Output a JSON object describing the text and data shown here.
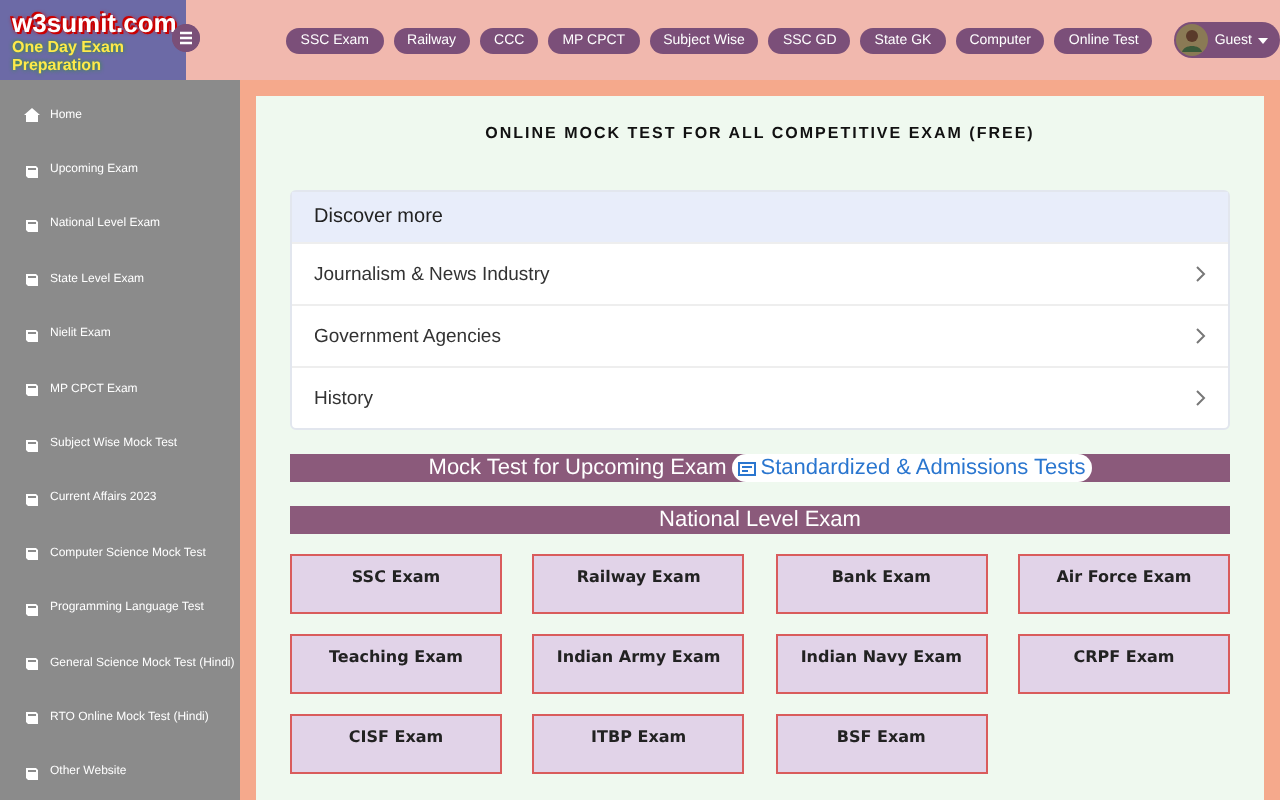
{
  "logo": {
    "title": "w3sumit.com",
    "tagline": "One Day Exam Preparation"
  },
  "nav": [
    "SSC Exam",
    "Railway",
    "CCC",
    "MP CPCT",
    "Subject Wise",
    "SSC GD",
    "State GK",
    "Computer",
    "Online Test"
  ],
  "user": {
    "label": "Guest"
  },
  "sidebar": {
    "items": [
      "Home",
      "Upcoming Exam",
      "National Level Exam",
      "State Level Exam",
      "Nielit Exam",
      "MP CPCT Exam",
      "Subject Wise Mock Test",
      "Current Affairs 2023",
      "Computer Science Mock Test",
      "Programming Language Test",
      "General Science Mock Test (Hindi)",
      "RTO Online Mock Test (Hindi)",
      "Other Website"
    ]
  },
  "page_title": "ONLINE MOCK TEST FOR ALL COMPETITIVE EXAM (FREE)",
  "discover": {
    "heading": "Discover more",
    "items": [
      "Journalism & News Industry",
      "Government Agencies",
      "History"
    ]
  },
  "upcoming_banner": {
    "text": "Mock Test for Upcoming Exam",
    "chip": "Standardized & Admissions Tests"
  },
  "section": {
    "heading": "National Level Exam",
    "exams": [
      "SSC Exam",
      "Railway Exam",
      "Bank Exam",
      "Air Force Exam",
      "Teaching Exam",
      "Indian Army Exam",
      "Indian Navy Exam",
      "CRPF Exam",
      "CISF Exam",
      "ITBP Exam",
      "BSF Exam"
    ]
  }
}
